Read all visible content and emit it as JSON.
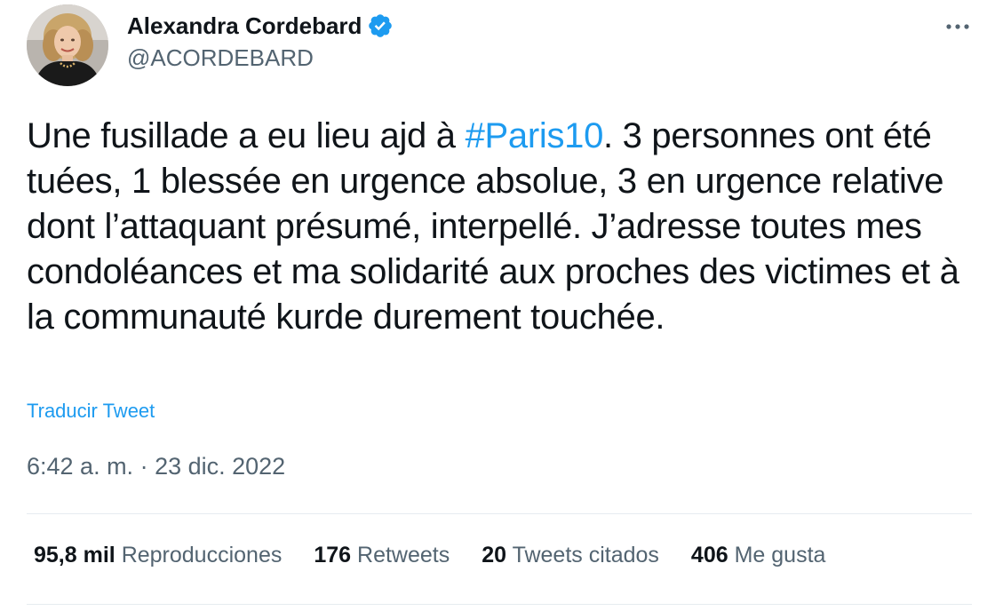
{
  "author": {
    "display_name": "Alexandra Cordebard",
    "handle": "@ACORDEBARD"
  },
  "tweet": {
    "text_before_hashtag": "Une fusillade a eu lieu ajd à ",
    "hashtag": "#Paris10",
    "text_after_hashtag": ". 3 personnes ont été tuées, 1 blessée en urgence absolue, 3 en urgence relative dont l’attaquant présumé, interpellé. J’adresse toutes mes condoléances et ma solidarité aux proches des victimes et à la communauté kurde durement touchée.",
    "translate_label": "Traducir Tweet",
    "time": "6:42 a. m.",
    "separator": " · ",
    "date": "23 dic. 2022"
  },
  "stats": {
    "views": {
      "count": "95,8 mil",
      "label": "Reproducciones"
    },
    "retweets": {
      "count": "176",
      "label": "Retweets"
    },
    "quotes": {
      "count": "20",
      "label": "Tweets citados"
    },
    "likes": {
      "count": "406",
      "label": "Me gusta"
    }
  },
  "icons": {
    "verified": "verified-badge-icon",
    "more": "more-options-icon"
  },
  "colors": {
    "accent": "#1d9bf0",
    "text_primary": "#0f1419",
    "text_secondary": "#536471",
    "divider": "#e6ecf0"
  }
}
